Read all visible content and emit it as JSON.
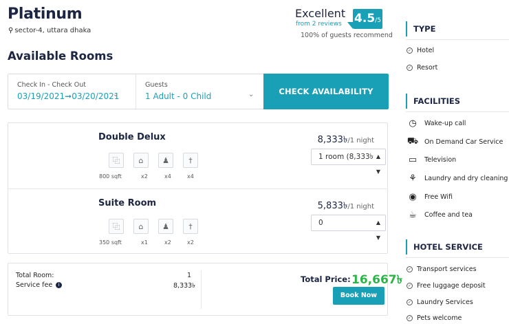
{
  "hotel": {
    "name": "Platinum",
    "location": "sector-4, uttara dhaka"
  },
  "rating": {
    "label": "Excellent",
    "reviews": "from 2 reviews",
    "recommend": "100% of guests recommend",
    "score": "4.5",
    "out_of": "/5"
  },
  "available_title": "Available Rooms",
  "search": {
    "dates_label": "Check In - Check Out",
    "dates_value": "03/19/2021➞03/20/2021",
    "guests_label": "Guests",
    "guests_value": "1 Adult - 0 Child",
    "check_button": "CHECK AVAILABILITY"
  },
  "rooms": [
    {
      "name": "Double Delux",
      "price": "8,333৳",
      "unit": "/1 night",
      "select_value": "1 room   (8,333৳",
      "amenities": [
        {
          "icon": "area-icon",
          "glyph": "⿻",
          "caption": "800 sqft"
        },
        {
          "icon": "bed-icon",
          "glyph": "⌂",
          "caption": "x2"
        },
        {
          "icon": "adults-icon",
          "glyph": "♟",
          "caption": "x4"
        },
        {
          "icon": "child-icon",
          "glyph": "†",
          "caption": "x4"
        }
      ]
    },
    {
      "name": "Suite Room",
      "price": "5,833৳",
      "unit": "/1 night",
      "select_value": "0",
      "amenities": [
        {
          "icon": "area-icon",
          "glyph": "⿻",
          "caption": "350 sqft"
        },
        {
          "icon": "bed-icon",
          "glyph": "⌂",
          "caption": "x1"
        },
        {
          "icon": "adults-icon",
          "glyph": "♟",
          "caption": "x2"
        },
        {
          "icon": "child-icon",
          "glyph": "†",
          "caption": "x2"
        }
      ]
    }
  ],
  "summary": {
    "total_room_label": "Total Room:",
    "total_room_value": "1",
    "service_fee_label": "Service fee",
    "service_fee_value": "8,333৳",
    "total_price_label": "Total Price:",
    "total_price_value": "16,667৳",
    "book_button": "Book Now"
  },
  "sidebar": {
    "type": {
      "title": "TYPE",
      "items": [
        "Hotel",
        "Resort"
      ]
    },
    "facilities": {
      "title": "FACILITIES",
      "items": [
        {
          "label": "Wake-up call",
          "icon": "clock-icon",
          "glyph": "◷"
        },
        {
          "label": "On Demand Car Service",
          "icon": "car-icon",
          "glyph": "⛟"
        },
        {
          "label": "Television",
          "icon": "tv-icon",
          "glyph": "▭"
        },
        {
          "label": "Laundry and dry cleaning",
          "icon": "laundry-icon",
          "glyph": "⚘"
        },
        {
          "label": "Free Wifi",
          "icon": "wifi-icon",
          "glyph": "◉"
        },
        {
          "label": "Coffee and tea",
          "icon": "coffee-icon",
          "glyph": "☕"
        }
      ]
    },
    "hotel_service": {
      "title": "HOTEL SERVICE",
      "items": [
        "Transport services",
        "Free luggage deposit",
        "Laundry Services",
        "Pets welcome"
      ]
    }
  },
  "colors": {
    "accent": "#1aa0b6",
    "total_price": "#2db34a",
    "heading": "#1c2541"
  }
}
